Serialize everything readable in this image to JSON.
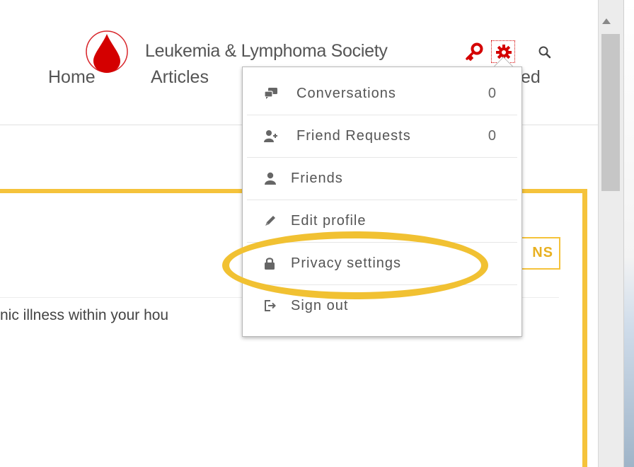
{
  "header": {
    "brand": "Leukemia & Lymphoma Society",
    "nav": {
      "home": "Home",
      "articles": "Articles",
      "partial": "ed"
    }
  },
  "content": {
    "options_button_text": "NS",
    "text_snippet": "nic illness within your hou"
  },
  "dropdown": {
    "items": [
      {
        "label": "Conversations",
        "count": "0",
        "icon": "conversations-icon"
      },
      {
        "label": "Friend Requests",
        "count": "0",
        "icon": "add-friend-icon"
      },
      {
        "label": "Friends",
        "icon": "person-icon"
      },
      {
        "label": "Edit profile",
        "icon": "pencil-icon"
      },
      {
        "label": "Privacy settings",
        "icon": "lock-icon"
      },
      {
        "label": "Sign out",
        "icon": "sign-out-icon"
      }
    ]
  },
  "colors": {
    "accent_yellow": "#f5c33b",
    "brand_red": "#d40000",
    "text_gray": "#555555"
  },
  "icons": {
    "logo": "blood-drop-logo",
    "key": "key-icon",
    "gear": "gear-icon",
    "search": "search-icon"
  }
}
